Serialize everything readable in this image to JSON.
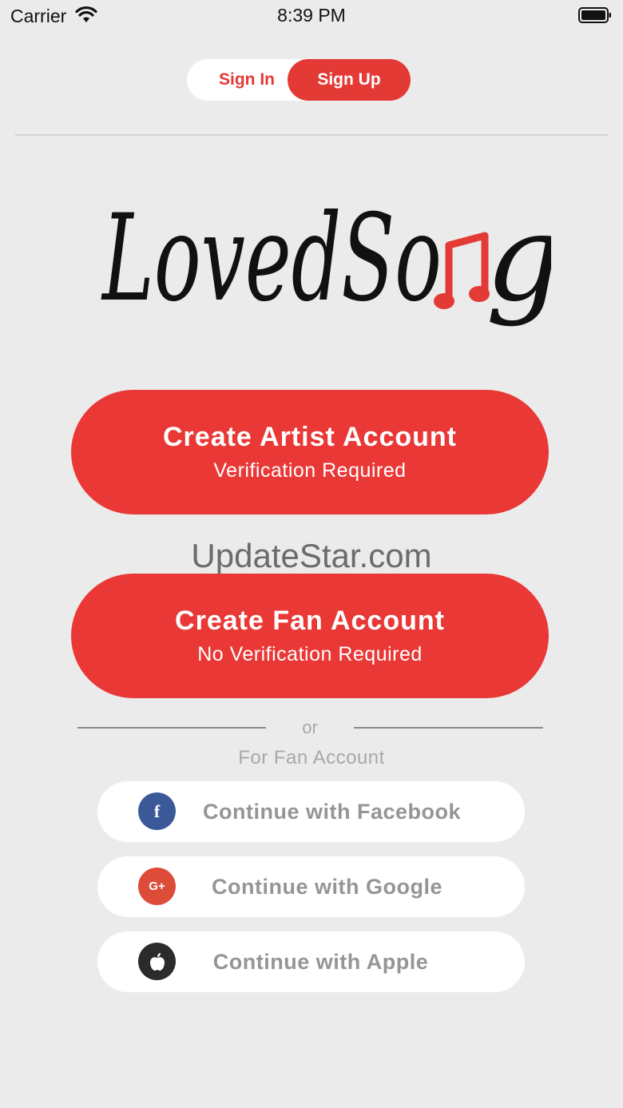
{
  "status_bar": {
    "carrier": "Carrier",
    "time": "8:39 PM",
    "wifi_icon": "wifi-icon",
    "battery_icon": "battery-icon"
  },
  "tabs": {
    "sign_in": "Sign In",
    "sign_up": "Sign Up",
    "active": "Sign Up"
  },
  "logo": {
    "text_main": "LovedSo",
    "text_end": "g",
    "note_icon": "music-note-icon"
  },
  "buttons": {
    "artist": {
      "title": "Create Artist Account",
      "subtitle": "Verification Required"
    },
    "fan": {
      "title": "Create Fan Account",
      "subtitle": "No Verification Required"
    }
  },
  "watermark": "UpdateStar.com",
  "divider": {
    "or": "or",
    "caption": "For Fan Account"
  },
  "social": {
    "facebook": {
      "label": "Continue with Facebook",
      "icon": "facebook-icon",
      "icon_text": "f"
    },
    "google": {
      "label": "Continue with Google",
      "icon": "google-plus-icon",
      "icon_text": "G+"
    },
    "apple": {
      "label": "Continue with Apple",
      "icon": "apple-icon"
    }
  },
  "colors": {
    "brand_red": "#e93836",
    "background": "#ebebeb",
    "facebook": "#3b5998",
    "google": "#dd4b39",
    "apple": "#2b2b2b"
  }
}
